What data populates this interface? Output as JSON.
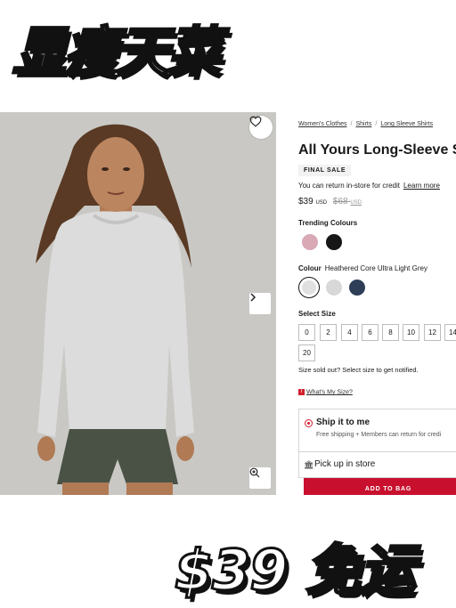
{
  "promo": {
    "headline_top": "显瘦天菜",
    "headline_bottom": "$39 免运"
  },
  "breadcrumb": {
    "items": [
      "Women's Clothes",
      "Shirts",
      "Long Sleeve Shirts"
    ],
    "separator": "/"
  },
  "product": {
    "title": "All Yours Long-Sleeve S",
    "badge": "FINAL SALE",
    "return_text": "You can return in-store for credit",
    "learn_more": "Learn more",
    "price": "$39",
    "price_currency": "USD",
    "original_price": "$68",
    "original_currency": "USD"
  },
  "trending": {
    "label": "Trending Colours",
    "swatches": [
      {
        "name": "pink",
        "color": "#d9a9b6"
      },
      {
        "name": "black",
        "color": "#161616"
      }
    ]
  },
  "colour": {
    "label": "Colour",
    "selected_name": "Heathered Core Ultra Light Grey",
    "swatches": [
      {
        "name": "heathered-core-ultra-light-grey",
        "color": "#e0e0e0"
      },
      {
        "name": "light-grey",
        "color": "#d8d8d8"
      },
      {
        "name": "navy",
        "color": "#2e3e57"
      }
    ]
  },
  "size": {
    "label": "Select Size",
    "options": [
      "0",
      "2",
      "4",
      "6",
      "8",
      "10",
      "12",
      "14",
      "20"
    ],
    "soldout_note": "Size sold out? Select size to get notified.",
    "guide_link": "What's My Size?"
  },
  "fulfillment": {
    "ship_title": "Ship it to me",
    "ship_sub": "Free shipping + Members can return for credi",
    "pickup_title": "Pick up in store"
  },
  "cta": {
    "add_to_bag": "ADD TO BAG"
  },
  "colors": {
    "accent": "#c8102e",
    "photo_bg": "#c9c8c4"
  }
}
